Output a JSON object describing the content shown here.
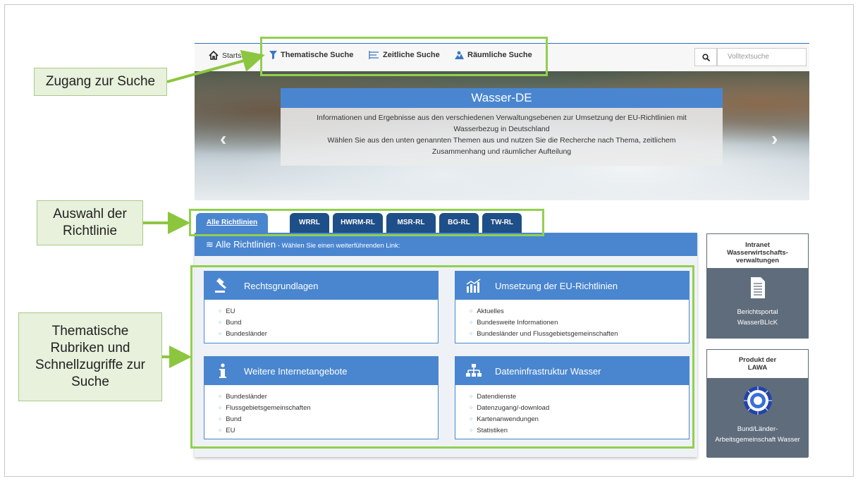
{
  "nav": {
    "home": "Startseite",
    "thematic": "Thematische Suche",
    "temporal": "Zeitliche Suche",
    "spatial": "Räumliche Suche",
    "search_placeholder": "Volltextsuche"
  },
  "hero": {
    "title": "Wasser-DE",
    "line1": "Informationen und Ergebnisse aus den verschiedenen Verwaltungsebenen zur Umsetzung der EU-Richtlinien mit",
    "line2": "Wasserbezug in Deutschland",
    "line3": "Wählen Sie aus den unten genannten Themen aus und nutzen Sie die Recherche nach Thema, zeitlichem",
    "line4": "Zusammenhang und räumlicher Aufteilung"
  },
  "tabs": [
    "Alle Richtlinien",
    "WRRL",
    "HWRM-RL",
    "MSR-RL",
    "BG-RL",
    "TW-RL"
  ],
  "panel": {
    "title": "≋ Alle Richtlinien",
    "subtitle": " - Wählen Sie einen weiterführenden Link:"
  },
  "cards": [
    {
      "title": "Rechtsgrundlagen",
      "icon": "gavel-icon",
      "items": [
        "EU",
        "Bund",
        "Bundesländer"
      ]
    },
    {
      "title": "Umsetzung der EU-Richtlinien",
      "icon": "bar-chart-icon",
      "items": [
        "Aktuelles",
        "Bundesweite Informationen",
        "Bundesländer und Flussgebietsgemeinschaften"
      ]
    },
    {
      "title": "Weitere Internetangebote",
      "icon": "info-icon",
      "items": [
        "Bundesländer",
        "Flussgebietsgemeinschaften",
        "Bund",
        "EU"
      ]
    },
    {
      "title": "Dateninfrastruktur Wasser",
      "icon": "sitemap-icon",
      "items": [
        "Datendienste",
        "Datenzugang/-download",
        "Kartenanwendungen",
        "Statistiken"
      ]
    }
  ],
  "side": {
    "intranet_head_1": "Intranet",
    "intranet_head_2": "Wasserwirtschafts-",
    "intranet_head_3": "verwaltungen",
    "intranet_body_1": "Berichtsportal",
    "intranet_body_2": "WasserBLIcK",
    "lawa_head_1": "Produkt der",
    "lawa_head_2": "LAWA",
    "lawa_body_1": "Bund/Länder-",
    "lawa_body_2": "Arbeitsgemeinschaft Wasser"
  },
  "annotations": {
    "a1": "Zugang zur Suche",
    "a2_1": "Auswahl der",
    "a2_2": "Richtlinie",
    "a3_1": "Thematische",
    "a3_2": "Rubriken und",
    "a3_3": "Schnellzugriffe zur",
    "a3_4": "Suche"
  },
  "colors": {
    "brand_blue": "#4a86cf",
    "dark_tab": "#1f4f88",
    "highlight_green": "#92d050",
    "annotation_bg": "#e7f1dc"
  }
}
